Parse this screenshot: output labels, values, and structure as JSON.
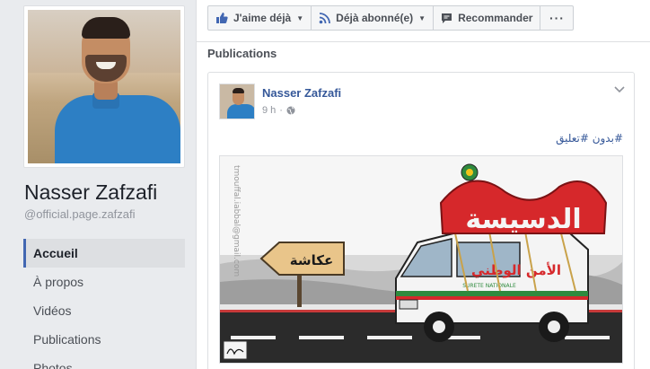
{
  "page": {
    "name": "Nasser Zafzafi",
    "handle": "@official.page.zafzafi"
  },
  "nav": {
    "items": [
      {
        "label": "Accueil",
        "active": true
      },
      {
        "label": "À propos",
        "active": false
      },
      {
        "label": "Vidéos",
        "active": false
      },
      {
        "label": "Publications",
        "active": false
      },
      {
        "label": "Photos",
        "active": false
      }
    ]
  },
  "actions": {
    "like_label": "J'aime déjà",
    "follow_label": "Déjà abonné(e)",
    "recommend_label": "Recommander",
    "more_label": "···"
  },
  "section": {
    "title": "Publications"
  },
  "post": {
    "author": "Nasser Zafzafi",
    "time": "9 h",
    "text": "#بدون #تعليق",
    "image": {
      "sign_text": "عكاشة",
      "banner_text": "الدسيسة",
      "van_text": "الأمن الوطني",
      "van_subtext": "SURETE NATIONALE",
      "watermark": "tmouffal.iabbal@gmail.com"
    }
  },
  "colors": {
    "accent": "#4267b2",
    "link": "#365899",
    "banner_red": "#d6282b"
  },
  "icons": {
    "like": "thumbs-up-icon",
    "follow": "rss-icon",
    "recommend": "chat-bubble-icon",
    "public": "globe-icon"
  }
}
